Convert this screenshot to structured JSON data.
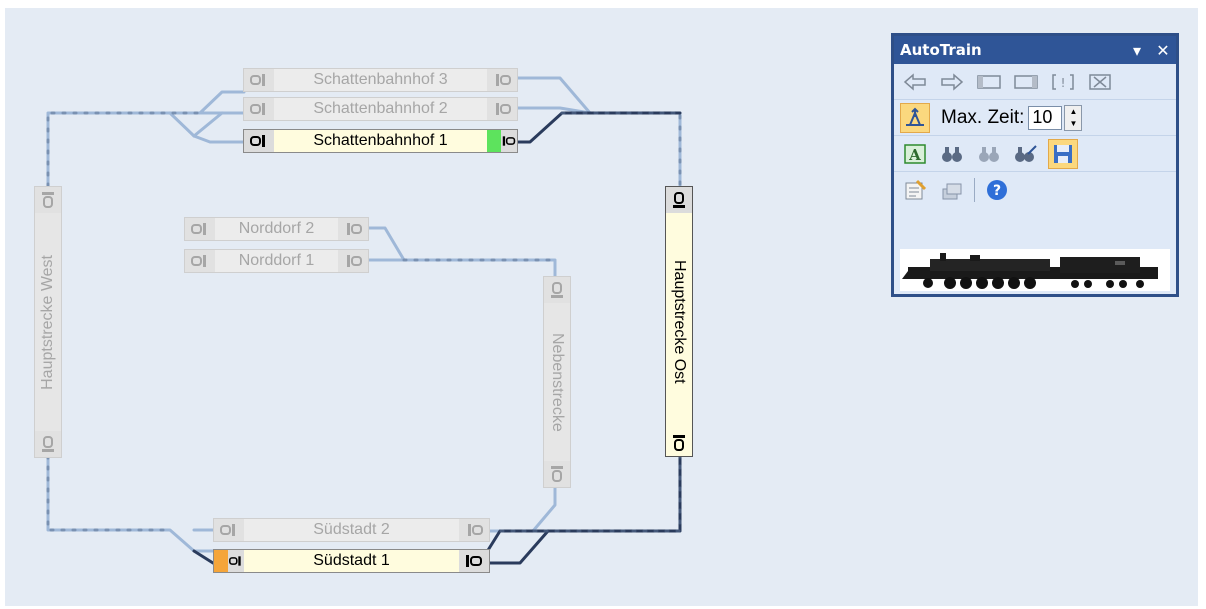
{
  "panel": {
    "title": "AutoTrain",
    "max_zeit_label": "Max. Zeit:",
    "max_zeit_value": "10"
  },
  "blocks": {
    "schattenbahnhof3": "Schattenbahnhof 3",
    "schattenbahnhof2": "Schattenbahnhof 2",
    "schattenbahnhof1": "Schattenbahnhof 1",
    "norddorf2": "Norddorf 2",
    "norddorf1": "Norddorf 1",
    "suedstadt2": "Südstadt 2",
    "suedstadt1": "Südstadt 1",
    "hauptstrecke_west": "Hauptstrecke West",
    "hauptstrecke_ost": "Hauptstrecke Ost",
    "nebenstrecke": "Nebenstrecke"
  },
  "colors": {
    "canvas_bg": "#e4ebf4",
    "track_inactive": "#9fb8d8",
    "track_active": "#1f2f4a",
    "block_active_bg": "#fffcde",
    "panel_title_bg": "#2f5597",
    "occupied_green": "#5de35d",
    "occupied_orange": "#f5a53a"
  }
}
